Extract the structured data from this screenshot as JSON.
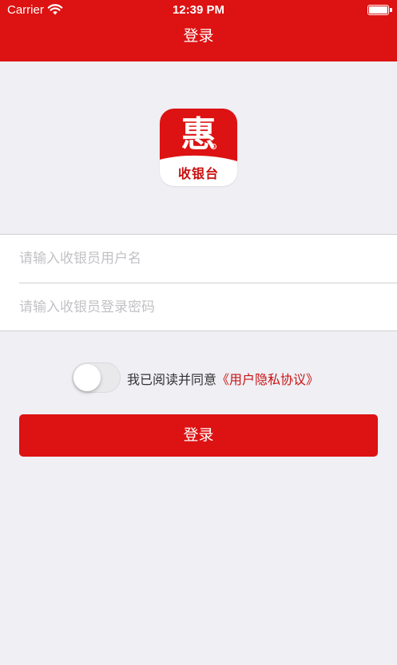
{
  "status_bar": {
    "carrier": "Carrier",
    "time": "12:39 PM",
    "wifi_icon": "wifi-icon",
    "battery_icon": "battery-icon"
  },
  "nav": {
    "title": "登录"
  },
  "logo": {
    "char": "惠",
    "text": "收银台",
    "icon": "app-logo-icon"
  },
  "form": {
    "username_placeholder": "请输入收银员用户名",
    "password_placeholder": "请输入收银员登录密码",
    "username_value": "",
    "password_value": ""
  },
  "agreement": {
    "toggle_on": false,
    "text": "我已阅读并同意",
    "link": "《用户隐私协议》"
  },
  "login_button": {
    "label": "登录"
  },
  "colors": {
    "accent": "#dd1212",
    "background": "#efeff4",
    "link": "#c81515"
  }
}
